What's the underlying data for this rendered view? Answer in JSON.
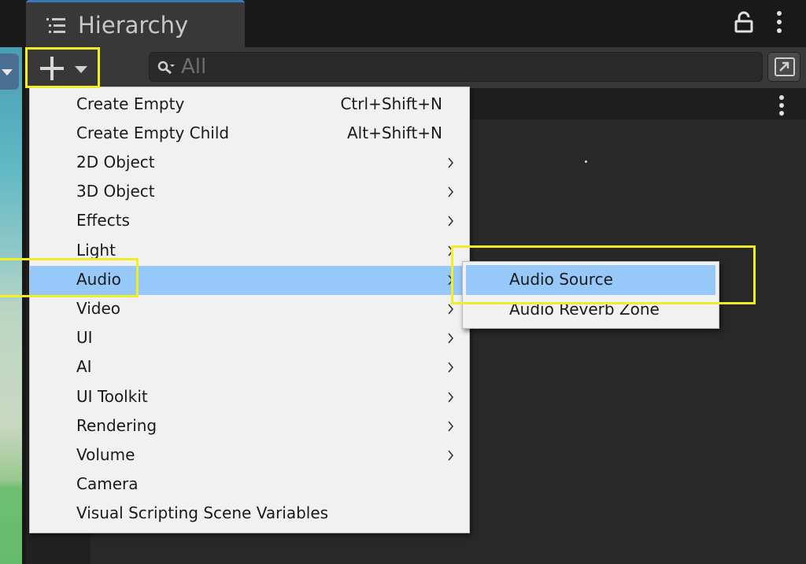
{
  "window": {
    "tab_title": "Hierarchy"
  },
  "icons": {
    "tab": "list-icon",
    "lock": "lock-icon",
    "menu": "kebab-icon",
    "add": "plus-icon",
    "search": "search-icon",
    "search_window": "open-search-window-icon"
  },
  "search": {
    "placeholder": "All"
  },
  "create_menu": {
    "items": [
      {
        "label": "Create Empty",
        "shortcut": "Ctrl+Shift+N",
        "submenu": false
      },
      {
        "label": "Create Empty Child",
        "shortcut": "Alt+Shift+N",
        "submenu": false
      },
      {
        "label": "2D Object",
        "shortcut": "",
        "submenu": true
      },
      {
        "label": "3D Object",
        "shortcut": "",
        "submenu": true
      },
      {
        "label": "Effects",
        "shortcut": "",
        "submenu": true
      },
      {
        "label": "Light",
        "shortcut": "",
        "submenu": true
      },
      {
        "label": "Audio",
        "shortcut": "",
        "submenu": true,
        "highlighted": true
      },
      {
        "label": "Video",
        "shortcut": "",
        "submenu": true
      },
      {
        "label": "UI",
        "shortcut": "",
        "submenu": true
      },
      {
        "label": "AI",
        "shortcut": "",
        "submenu": true
      },
      {
        "label": "UI Toolkit",
        "shortcut": "",
        "submenu": true
      },
      {
        "label": "Rendering",
        "shortcut": "",
        "submenu": true
      },
      {
        "label": "Volume",
        "shortcut": "",
        "submenu": true
      },
      {
        "label": "Camera",
        "shortcut": "",
        "submenu": false
      },
      {
        "label": "Visual Scripting Scene Variables",
        "shortcut": "",
        "submenu": false
      }
    ]
  },
  "audio_submenu": {
    "items": [
      {
        "label": "Audio Source",
        "highlighted": true
      },
      {
        "label": "Audio Reverb Zone",
        "highlighted": false
      }
    ]
  },
  "colors": {
    "highlight": "#96c9f9",
    "annotation": "#f2ee26",
    "panel": "#383838",
    "menu_bg": "#f1f1f1"
  }
}
